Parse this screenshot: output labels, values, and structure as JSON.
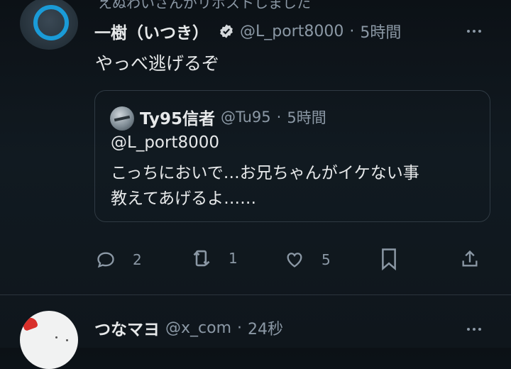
{
  "repost": {
    "text": "えぬわいさんがリポストしました"
  },
  "tweet": {
    "display_name": "一樹（いつき）",
    "handle": "@L_port8000",
    "separator": "·",
    "time": "5時間",
    "text": "やっべ逃げるぞ",
    "quote": {
      "display_name": "Ty95信者",
      "handle": "@Tu95",
      "separator": "·",
      "time": "5時間",
      "lines": [
        "@L_port8000",
        "こっちにおいで…お兄ちゃんがイケない事",
        "教えてあげるよ……"
      ]
    },
    "actions": {
      "reply_count": "2",
      "repost_count": "1",
      "like_count": "5"
    }
  },
  "next_tweet": {
    "display_name": "つなマヨ",
    "handle": "@x_com",
    "separator": "·",
    "time": "24秒"
  },
  "colors": {
    "background": "#0f161c",
    "text": "#e7e9ea",
    "muted": "#8b98a5",
    "border": "#2f3a43",
    "avatar_ring": "#1a9bd7"
  },
  "icons": [
    "repost-icon",
    "verified-icon",
    "more-icon",
    "reply-icon",
    "repost-icon",
    "like-icon",
    "bookmark-icon",
    "share-icon"
  ]
}
